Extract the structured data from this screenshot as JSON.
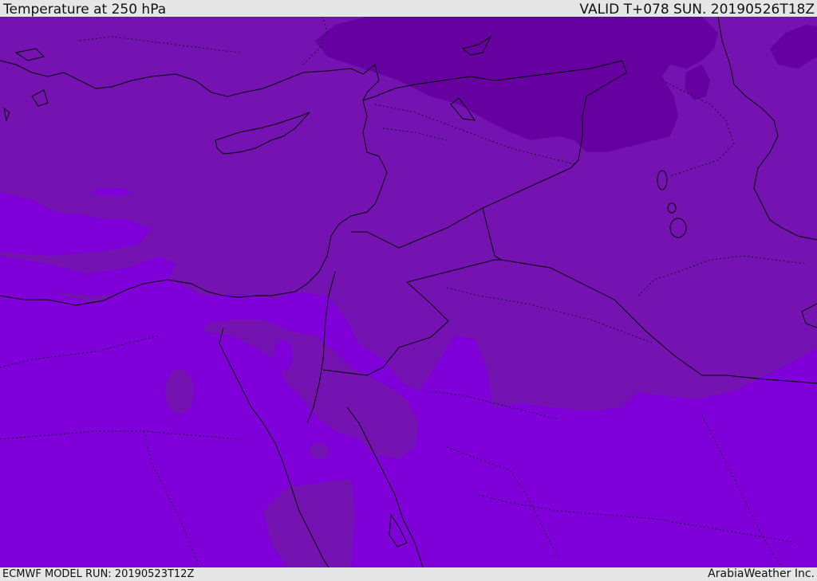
{
  "header": {
    "title": "Temperature at 250 hPa",
    "valid": "VALID T+078 SUN. 20190526T18Z"
  },
  "footer": {
    "model_run": "ECMWF MODEL RUN: 20190523T12Z",
    "credit": "ArabiaWeather Inc."
  },
  "map": {
    "fill_colors": {
      "coldest": "#6600a0",
      "cold": "#7512b2",
      "mid": "#7f00d9",
      "warm": "#8200dd",
      "light": "#8a1ae8"
    },
    "border_color": "#000000"
  }
}
